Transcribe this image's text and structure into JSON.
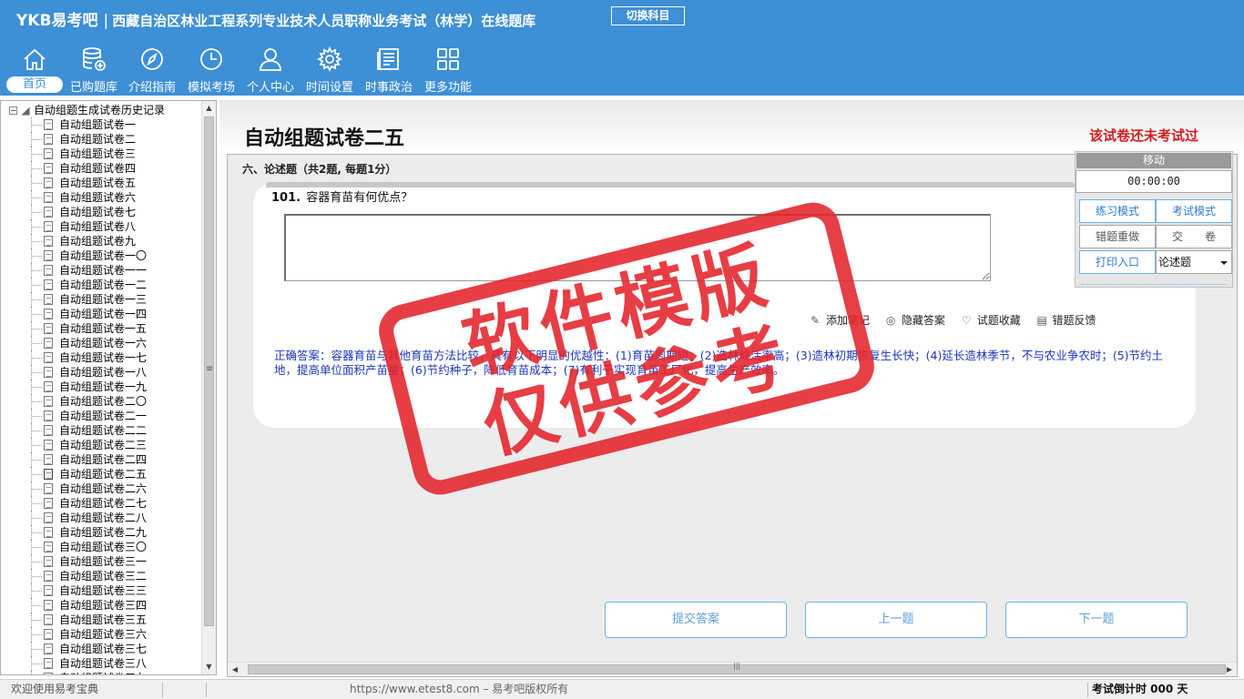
{
  "app": {
    "brand": "YKB易考吧",
    "title": "西藏自治区林业工程系列专业技术人员职称业务考试（林学）在线题库",
    "switch_label": "切换科目"
  },
  "nav": [
    {
      "label": "首页",
      "icon": "home-icon"
    },
    {
      "label": "已购题库",
      "icon": "database-icon"
    },
    {
      "label": "介绍指南",
      "icon": "compass-icon"
    },
    {
      "label": "模拟考场",
      "icon": "clock-icon"
    },
    {
      "label": "个人中心",
      "icon": "user-icon"
    },
    {
      "label": "时间设置",
      "icon": "gear-icon"
    },
    {
      "label": "时事政治",
      "icon": "newspaper-icon"
    },
    {
      "label": "更多功能",
      "icon": "grid-icon"
    }
  ],
  "sidebar": {
    "root_label": "自动组题生成试卷历史记录",
    "items": [
      "自动组题试卷一",
      "自动组题试卷二",
      "自动组题试卷三",
      "自动组题试卷四",
      "自动组题试卷五",
      "自动组题试卷六",
      "自动组题试卷七",
      "自动组题试卷八",
      "自动组题试卷九",
      "自动组题试卷一〇",
      "自动组题试卷一一",
      "自动组题试卷一二",
      "自动组题试卷一三",
      "自动组题试卷一四",
      "自动组题试卷一五",
      "自动组题试卷一六",
      "自动组题试卷一七",
      "自动组题试卷一八",
      "自动组题试卷一九",
      "自动组题试卷二〇",
      "自动组题试卷二一",
      "自动组题试卷二二",
      "自动组题试卷二三",
      "自动组题试卷二四",
      "自动组题试卷二五",
      "自动组题试卷二六",
      "自动组题试卷二七",
      "自动组题试卷二八",
      "自动组题试卷二九",
      "自动组题试卷三〇",
      "自动组题试卷三一",
      "自动组题试卷三二",
      "自动组题试卷三三",
      "自动组题试卷三四",
      "自动组题试卷三五",
      "自动组题试卷三六",
      "自动组题试卷三七",
      "自动组题试卷三八",
      "自动组题试卷三九"
    ],
    "current_item": "自动组题试卷二五"
  },
  "main": {
    "paper_title": "自动组题试卷二五",
    "paper_status": "该试卷还未考试过",
    "section_header": "六、论述题（共2题, 每题1分）",
    "question": {
      "number": "101.",
      "text": "容器育苗有何优点？",
      "answer_value": "",
      "actions": [
        "添加笔记",
        "隐藏答案",
        "试题收藏",
        "错题反馈"
      ],
      "answer": "正确答案：容器育苗与其他育苗方法比较，具有以下明显的优越性：(1)育苗周期短；(2)造林成活率高；(3)造林初期恢复生长快；(4)延长造林季节，不与农业争农时；(5)节约土地，提高单位面积产苗量；(6)节约种子，降低育苗成本；(7)有利于实现育苗工厂化，提高生产效率。"
    },
    "buttons": {
      "submit": "提交答案",
      "prev": "上一题",
      "next": "下一题"
    }
  },
  "control": {
    "move_label": "移动",
    "timer": "00:00:00",
    "practice_mode": "练习模式",
    "exam_mode": "考试模式",
    "redo_wrong": "错题重做",
    "hand_in": "交　　卷",
    "print_entry": "打印入口",
    "question_type": "论述题"
  },
  "watermark": {
    "line1": "软件模版",
    "line2": "仅供参考"
  },
  "status": {
    "welcome": "欢迎使用易考宝典",
    "url": "https://www.etest8.com – 易考吧版权所有",
    "countdown": "考试倒计时 000 天"
  },
  "colors": {
    "header": "#3d8fd6",
    "status_red": "#d21c1c",
    "answer_blue": "#1c37b8",
    "stamp_red": "#e3242b"
  }
}
